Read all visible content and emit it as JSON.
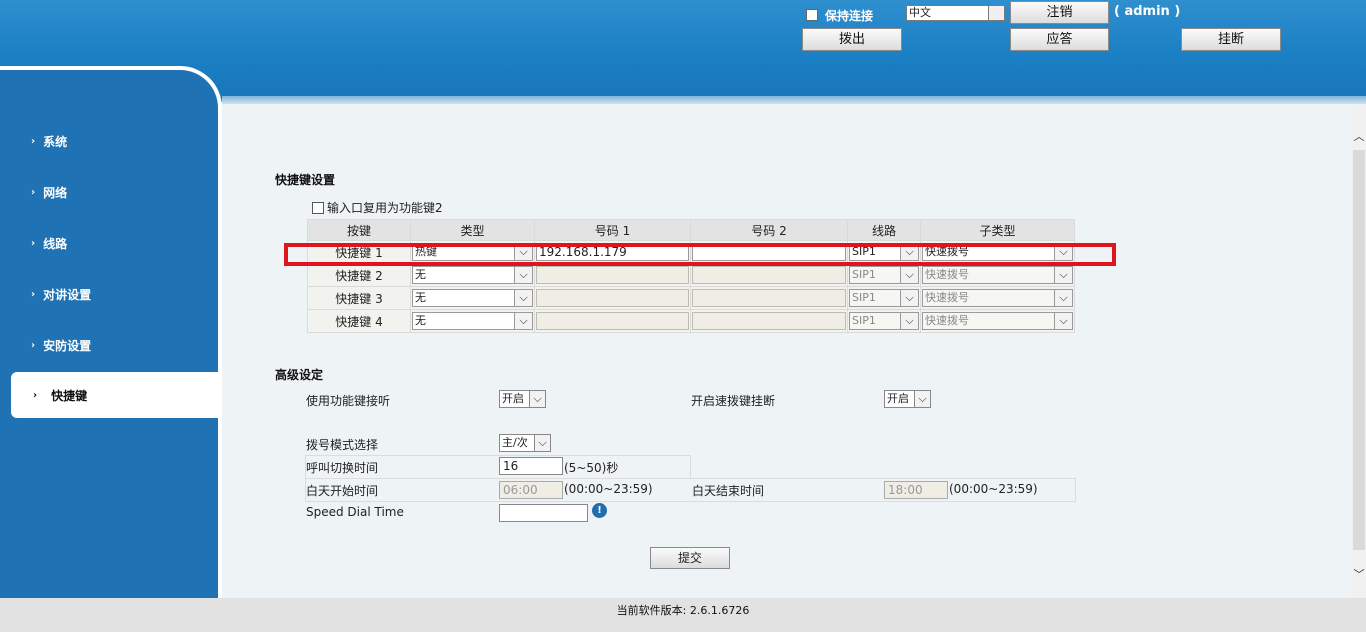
{
  "header": {
    "keep_connection": "保持连接",
    "language": "中文",
    "logout": "注销",
    "user": "( admin )",
    "dial": "拨出",
    "answer": "应答",
    "hangup": "挂断"
  },
  "sidebar": {
    "items": [
      {
        "label": "系统"
      },
      {
        "label": "网络"
      },
      {
        "label": "线路"
      },
      {
        "label": "对讲设置"
      },
      {
        "label": "安防设置"
      },
      {
        "label": "快捷键"
      }
    ]
  },
  "hotkeys": {
    "title": "快捷键设置",
    "reuse_label": "输入口复用为功能键2",
    "headers": [
      "按键",
      "类型",
      "号码 1",
      "号码 2",
      "线路",
      "子类型"
    ],
    "rows": [
      {
        "key": "快捷键 1",
        "type": "热键",
        "num1": "192.168.1.179",
        "num2": "",
        "line": "SIP1",
        "subtype": "快速拨号"
      },
      {
        "key": "快捷键 2",
        "type": "无",
        "num1": "",
        "num2": "",
        "line": "SIP1",
        "subtype": "快速拨号"
      },
      {
        "key": "快捷键 3",
        "type": "无",
        "num1": "",
        "num2": "",
        "line": "SIP1",
        "subtype": "快速拨号"
      },
      {
        "key": "快捷键 4",
        "type": "无",
        "num1": "",
        "num2": "",
        "line": "SIP1",
        "subtype": "快速拨号"
      }
    ]
  },
  "advanced": {
    "title": "高级设定",
    "use_func_key_answer": {
      "label": "使用功能键接听",
      "value": "开启"
    },
    "speed_dial_hangup": {
      "label": "开启速拨键挂断",
      "value": "开启"
    },
    "dial_mode": {
      "label": "拨号模式选择",
      "value": "主/次"
    },
    "call_switch_time": {
      "label": "呼叫切换时间",
      "value": "16",
      "hint": "(5~50)秒"
    },
    "day_start": {
      "label": "白天开始时间",
      "value": "06:00",
      "hint": "(00:00~23:59)"
    },
    "day_end": {
      "label": "白天结束时间",
      "value": "18:00",
      "hint": "(00:00~23:59)"
    },
    "speed_dial_time": {
      "label": "Speed Dial Time",
      "value": ""
    }
  },
  "submit": "提交",
  "footer": "当前软件版本: 2.6.1.6726"
}
